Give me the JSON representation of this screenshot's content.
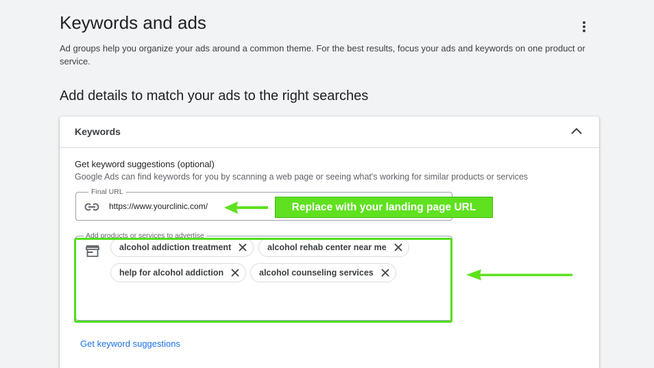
{
  "page": {
    "title": "Keywords and ads",
    "description": "Ad groups help you organize your ads around a common theme. For the best results, focus your ads and keywords on one product or service.",
    "section_title": "Add details to match your ads to the right searches"
  },
  "card": {
    "header_title": "Keywords",
    "suggestions_title": "Get keyword suggestions (optional)",
    "suggestions_desc": "Google Ads can find keywords for you by scanning a web page or seeing what's working for similar products or services",
    "final_url": {
      "label": "Final URL",
      "value": "https://www.yourclinic.com/"
    },
    "products": {
      "label": "Add products or services to advertise",
      "chips": [
        "alcohol addiction treatment",
        "alcohol rehab center near me",
        "help for alcohol addiction",
        "alcohol counseling services"
      ]
    },
    "link_label": "Get keyword suggestions"
  },
  "annotation": {
    "callout_text": "Replace with your landing page URL",
    "color": "#5fe11f"
  },
  "icons": {
    "more": "more-vert-icon",
    "collapse": "chevron-up-icon",
    "link": "link-icon",
    "store": "storefront-icon",
    "remove": "close-icon"
  }
}
